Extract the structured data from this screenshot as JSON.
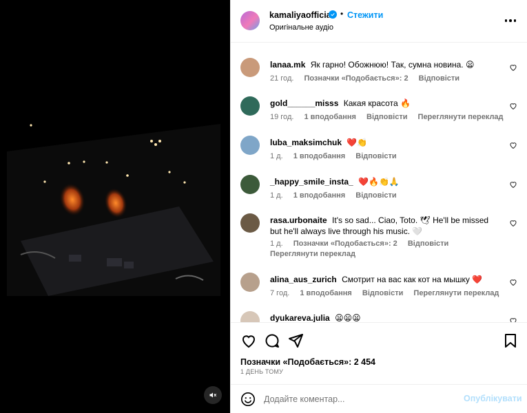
{
  "post": {
    "username": "kamaliyaofficial",
    "follow_label": "Стежити",
    "separator": "•",
    "audio": "Оригінальне аудіо",
    "more_icon": "more-horizontal-icon"
  },
  "comments": [
    {
      "username": "lanaa.mk",
      "text": "Як гарно! Обожнюю! Так, сумна новина. 😦",
      "meta": [
        "21 год.",
        "Позначки «Подобається»: 2",
        "Відповісти"
      ]
    },
    {
      "username": "gold______misss",
      "text": "Какая красота 🔥",
      "meta": [
        "19 год.",
        "1 вподобання",
        "Відповісти",
        "Переглянути переклад"
      ]
    },
    {
      "username": "luba_maksimchuk",
      "text": "❤️👏",
      "meta": [
        "1 д.",
        "1 вподобання",
        "Відповісти"
      ]
    },
    {
      "username": "_happy_smile_insta_",
      "text": "❤️🔥👏🙏",
      "meta": [
        "1 д.",
        "1 вподобання",
        "Відповісти"
      ]
    },
    {
      "username": "rasa.urbonaite",
      "text": "It's so sad... Ciao, Toto. 🕊 He'll be missed but he'll always live through his music. 🤍",
      "meta": [
        "1 д.",
        "Позначки «Подобається»: 2",
        "Відповісти"
      ],
      "meta2": "Переглянути переклад"
    },
    {
      "username": "alina_aus_zurich",
      "text": "Смотрит на вас как кот на мышку ❤️",
      "meta": [
        "7 год.",
        "1 вподобання",
        "Відповісти",
        "Переглянути переклад"
      ]
    },
    {
      "username": "dyukareva.julia",
      "text": "😦😦😦",
      "meta": []
    }
  ],
  "actions": {
    "likes_label": "Позначки «Подобається»: 2 454",
    "time_ago": "1 ДЕНЬ ТОМУ"
  },
  "composer": {
    "placeholder": "Додайте коментар...",
    "post_label": "Опублікувати"
  },
  "colors": {
    "accent": "#0095f6",
    "muted": "#737373",
    "heart_red": "#ed4956"
  }
}
